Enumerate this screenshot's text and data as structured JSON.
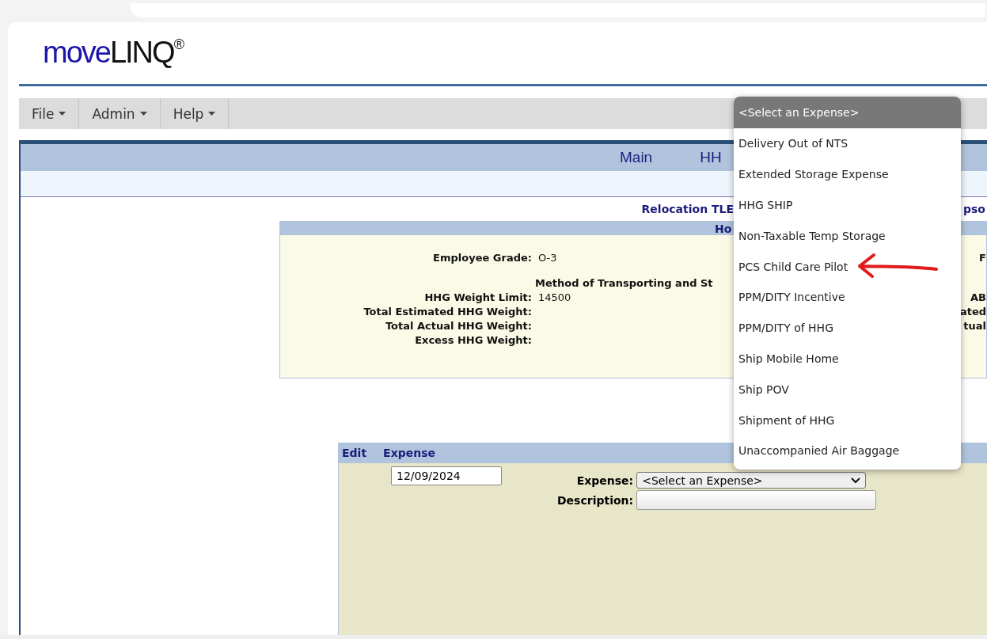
{
  "logo": {
    "parts": [
      "move",
      "LINQ",
      "®"
    ]
  },
  "menu": [
    {
      "label": "File"
    },
    {
      "label": "Admin"
    },
    {
      "label": "Help"
    }
  ],
  "tabs": [
    {
      "label": "Main"
    },
    {
      "label": "HH"
    }
  ],
  "record_title": {
    "text": "Relocation TLE",
    "right_text": "pso"
  },
  "section": {
    "title": "Ho",
    "grade": {
      "label": "Employee Grade:",
      "value": "O-3",
      "side": "F"
    },
    "method_heading": "Method of Transporting and St",
    "weights": [
      {
        "label": "HHG Weight Limit:",
        "value": "14500",
        "side": "AB"
      },
      {
        "label": "Total Estimated HHG Weight:",
        "side": "ated"
      },
      {
        "label": "Total Actual HHG Weight:",
        "side": "tual"
      },
      {
        "label": "Excess HHG Weight:"
      }
    ]
  },
  "expenses": {
    "columns": [
      "Edit",
      "Expense"
    ],
    "date": "12/09/2024",
    "expense_label": "Expense:",
    "expense_value": "<Select an Expense>",
    "description_label": "Description:"
  },
  "dropdown": {
    "options": [
      {
        "label": "<Select an Expense>",
        "selected": true
      },
      {
        "label": "Delivery Out of NTS",
        "selected": false
      },
      {
        "label": "Extended Storage Expense",
        "selected": false
      },
      {
        "label": "HHG SHIP",
        "selected": false
      },
      {
        "label": "Non-Taxable Temp Storage",
        "selected": false
      },
      {
        "label": "PCS Child Care Pilot",
        "selected": false
      },
      {
        "label": "PPM/DITY Incentive",
        "selected": false
      },
      {
        "label": "PPM/DITY of HHG",
        "selected": false
      },
      {
        "label": "Ship Mobile Home",
        "selected": false
      },
      {
        "label": "Ship POV",
        "selected": false
      },
      {
        "label": "Shipment of HHG",
        "selected": false
      },
      {
        "label": "Unaccompanied Air Baggage",
        "selected": false
      }
    ]
  }
}
